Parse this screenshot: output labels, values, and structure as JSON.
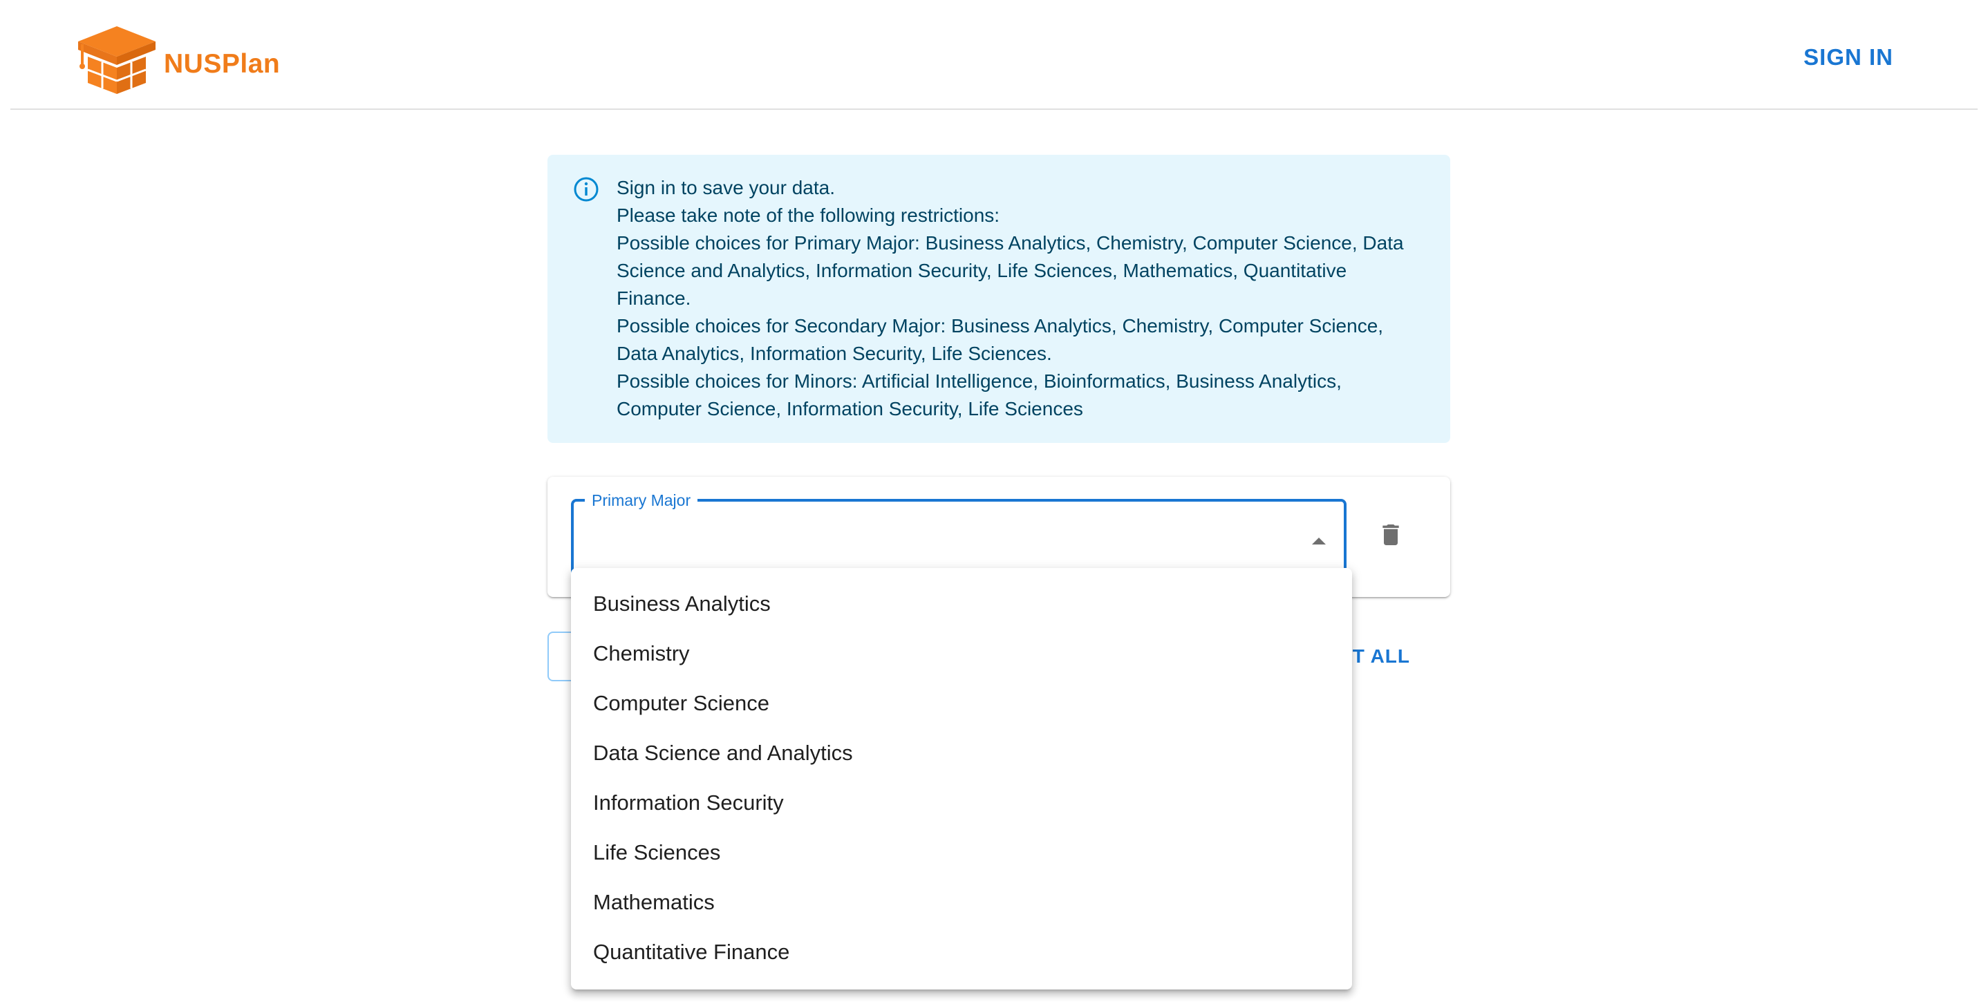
{
  "header": {
    "brand_name": "NUSPlan",
    "sign_in_label": "SIGN IN"
  },
  "info": {
    "lines": [
      "Sign in to save your data.",
      "Please take note of the following restrictions:",
      "Possible choices for Primary Major: Business Analytics, Chemistry, Computer Science, Data Science and Analytics, Information Security, Life Sciences, Mathematics, Quantitative Finance.",
      "Possible choices for Secondary Major: Business Analytics, Chemistry, Computer Science, Data Analytics, Information Security, Life Sciences.",
      "Possible choices for Minors: Artificial Intelligence, Bioinformatics, Business Analytics, Computer Science, Information Security, Life Sciences"
    ]
  },
  "primary_major": {
    "label": "Primary Major",
    "value": "",
    "options": [
      "Business Analytics",
      "Chemistry",
      "Computer Science",
      "Data Science and Analytics",
      "Information Security",
      "Life Sciences",
      "Mathematics",
      "Quantitative Finance"
    ]
  },
  "actions": {
    "partial_label": "T ALL"
  },
  "icons": {
    "logo": "graduation-cap-box-icon",
    "info": "info-icon",
    "delete": "trash-icon",
    "dropdown": "caret-up-icon"
  },
  "colors": {
    "brand": "#f07c1a",
    "primary": "#1976d2",
    "info_bg": "#e5f6fd",
    "info_text": "#014361"
  }
}
